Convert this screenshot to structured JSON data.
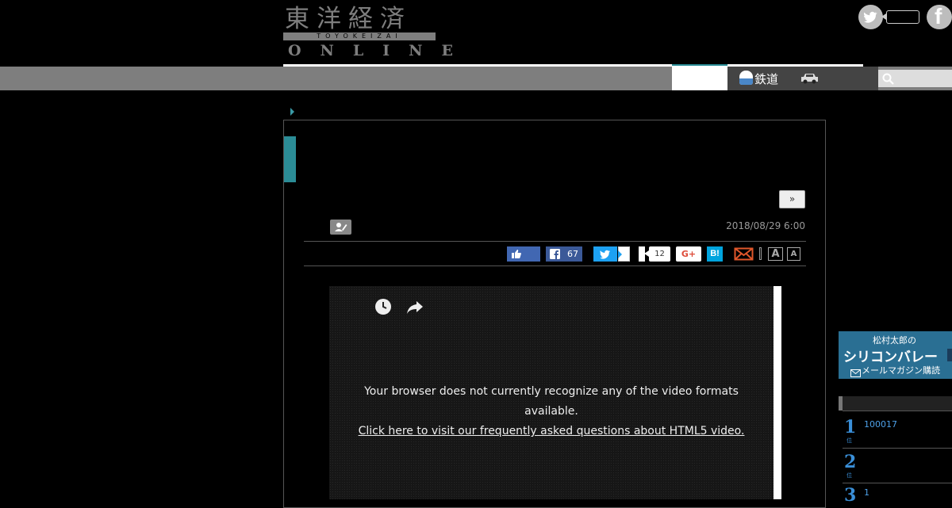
{
  "header": {
    "logo_kanji": "東洋経済",
    "logo_band": "TOYOKEIZAI",
    "logo_online": "ONLINE",
    "social": [
      "twitter-icon",
      "facebook-icon"
    ]
  },
  "nav": {
    "rail_label": "鉄道",
    "search_icon": "search-icon"
  },
  "article": {
    "next_label": "»",
    "date": "2018/08/29 6:00",
    "share": {
      "fb_count": "67",
      "pocket_count": "12",
      "gplus_label": "G+",
      "hatena_label": "B!",
      "font_large": "A",
      "font_small": "A"
    }
  },
  "video": {
    "message_line1": "Your browser does not currently recognize any of the video formats",
    "message_line2": "available.",
    "link_text": "Click here to visit our frequently asked questions about HTML5 video."
  },
  "sidebar": {
    "banner_top": "松村太郎の",
    "banner_mid": "シリコンバレー",
    "banner_bot": "メールマガジン購読",
    "ranking": [
      {
        "num": "1",
        "text": "100017"
      },
      {
        "num": "2",
        "text": ""
      },
      {
        "num": "3",
        "text": "1"
      }
    ]
  },
  "colors": {
    "accent": "#2b8c96",
    "nav_gray": "#7e7e7e",
    "link_blue": "#3a8fd8"
  }
}
